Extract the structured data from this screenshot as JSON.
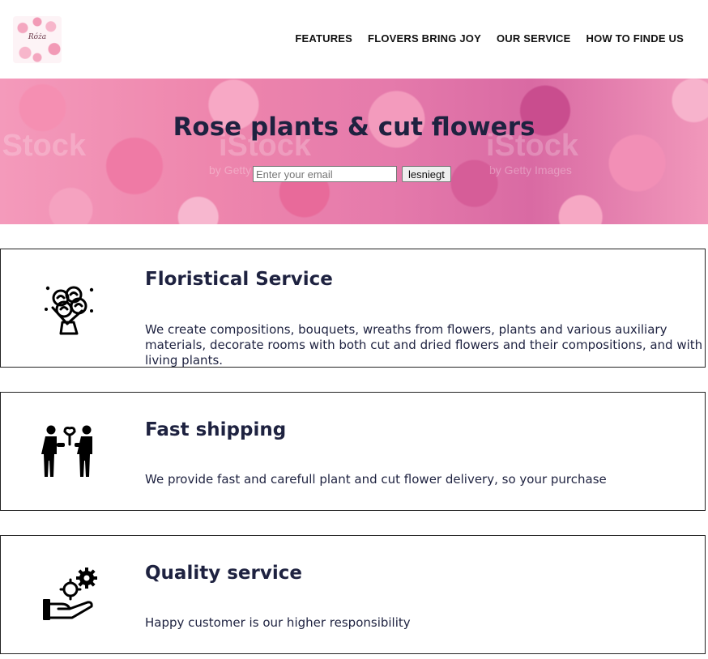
{
  "header": {
    "logo_text": "Róża",
    "nav": [
      "FEATURES",
      "FLOVERS BRING JOY",
      "OUR SERVICE",
      "HOW TO FINDE US"
    ]
  },
  "hero": {
    "title": "Rose plants & cut flowers",
    "email_placeholder": "Enter your email",
    "submit_label": "lesniegt",
    "watermarks": [
      "iStock",
      "by Getty Images"
    ]
  },
  "features": [
    {
      "icon": "bouquet-icon",
      "title": "Floristical Service",
      "text": "We create compositions, bouquets, wreaths from flowers, plants and various auxiliary materials, decorate rooms with both cut and dried flowers and their compositions, and with living plants."
    },
    {
      "icon": "delivery-people-icon",
      "title": "Fast shipping",
      "text": "We provide fast and carefull plant and cut flower delivery, so your purchase"
    },
    {
      "icon": "hand-gears-icon",
      "title": "Quality service",
      "text": "Happy customer is our higher responsibility"
    }
  ]
}
